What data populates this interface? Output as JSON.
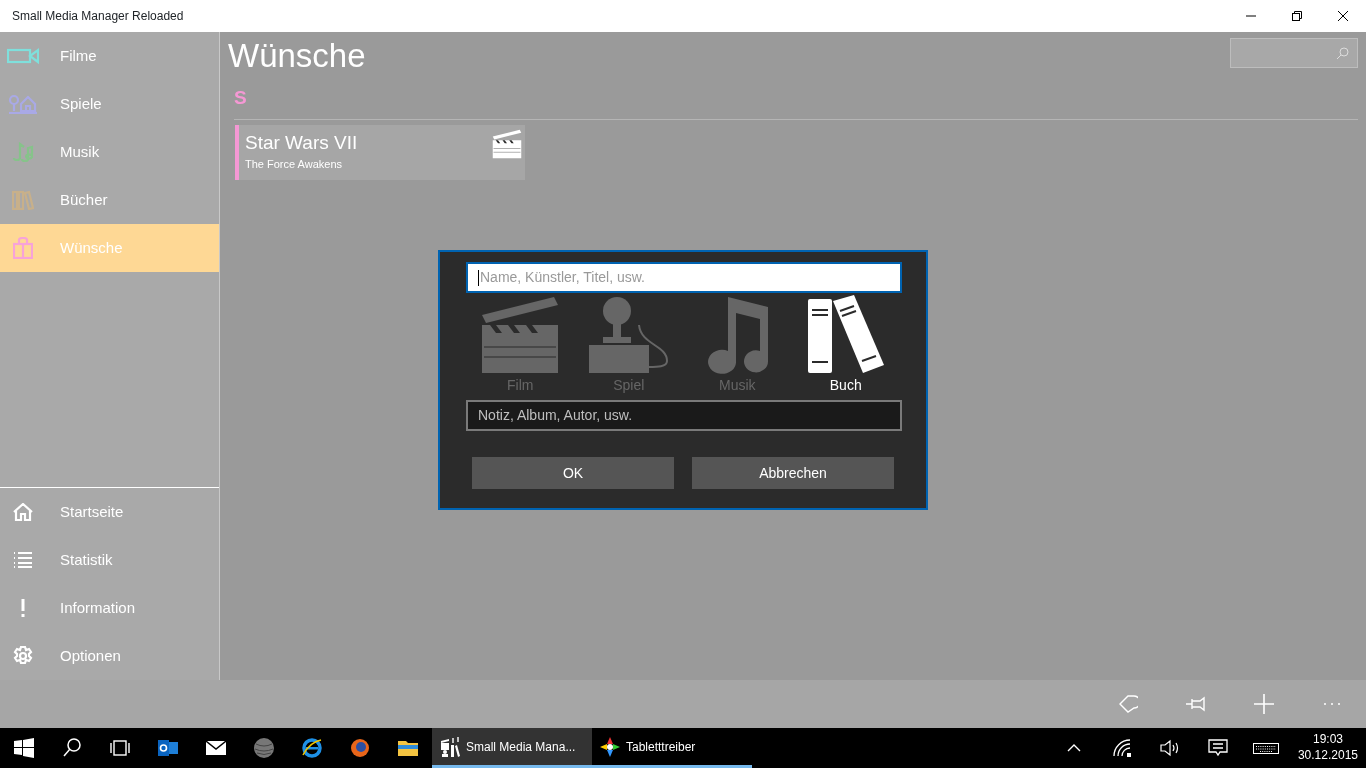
{
  "window": {
    "title": "Small Media Manager Reloaded"
  },
  "nav": {
    "items": [
      {
        "label": "Filme",
        "kind": "film",
        "color": "#7fe0dc",
        "selected": false
      },
      {
        "label": "Spiele",
        "kind": "game",
        "color": "#a9a9e6",
        "selected": false
      },
      {
        "label": "Musik",
        "kind": "music",
        "color": "#86c38a",
        "selected": false
      },
      {
        "label": "Bücher",
        "kind": "books",
        "color": "#c8b08a",
        "selected": false
      },
      {
        "label": "Wünsche",
        "kind": "gift",
        "color": "#f7a3d8",
        "selected": true
      }
    ],
    "footer_items": [
      {
        "label": "Startseite",
        "kind": "home"
      },
      {
        "label": "Statistik",
        "kind": "list"
      },
      {
        "label": "Information",
        "kind": "info"
      },
      {
        "label": "Optionen",
        "kind": "gear"
      }
    ]
  },
  "page": {
    "title": "Wünsche",
    "groups": [
      {
        "letter": "S",
        "items": [
          {
            "title": "Star Wars VII",
            "subtitle": "The Force Awakens",
            "kind": "film"
          }
        ]
      }
    ]
  },
  "dialog": {
    "name_placeholder": "Name, Künstler, Titel, usw.",
    "types": [
      {
        "label": "Film",
        "kind": "film",
        "selected": false
      },
      {
        "label": "Spiel",
        "kind": "game",
        "selected": false
      },
      {
        "label": "Musik",
        "kind": "music",
        "selected": false
      },
      {
        "label": "Buch",
        "kind": "books",
        "selected": true
      }
    ],
    "note_placeholder": "Notiz, Album, Autor, usw.",
    "buttons": [
      "OK",
      "Abbrechen"
    ]
  },
  "taskbar": {
    "apps": [
      {
        "kind": "outlook",
        "selected": false,
        "running": false
      },
      {
        "kind": "mail",
        "selected": false,
        "running": false
      },
      {
        "kind": "globe",
        "selected": false,
        "running": false
      },
      {
        "kind": "ie",
        "selected": false,
        "running": false
      },
      {
        "kind": "firefox",
        "selected": false,
        "running": false
      },
      {
        "kind": "folder",
        "selected": false,
        "running": false
      },
      {
        "kind": "smm",
        "label": "Small Media Mana...",
        "selected": true,
        "running": true
      },
      {
        "kind": "tablet",
        "label": "Tabletttreiber",
        "selected": false,
        "running": true
      }
    ],
    "time": "19:03",
    "date": "30.12.2015"
  }
}
